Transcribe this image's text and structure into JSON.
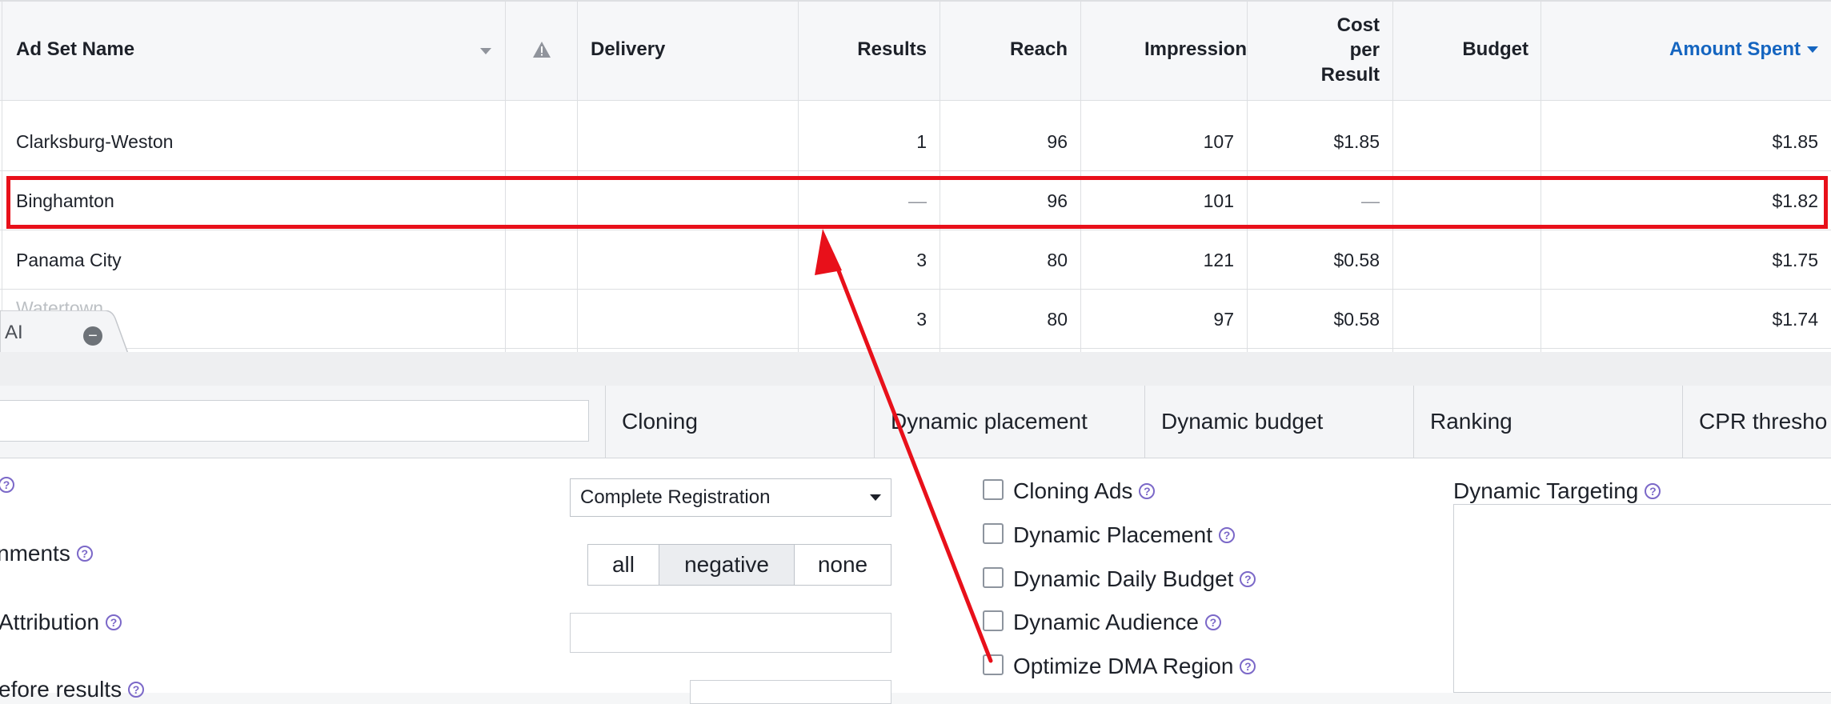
{
  "table": {
    "columns": [
      {
        "key": "name",
        "label": "Ad Set Name"
      },
      {
        "key": "warn",
        "label": ""
      },
      {
        "key": "delivery",
        "label": "Delivery"
      },
      {
        "key": "results",
        "label": "Results"
      },
      {
        "key": "reach",
        "label": "Reach"
      },
      {
        "key": "impressions",
        "label": "Impression"
      },
      {
        "key": "cpr",
        "label": "Cost\nper\nResult"
      },
      {
        "key": "budget",
        "label": "Budget"
      },
      {
        "key": "spent",
        "label": "Amount Spent"
      }
    ],
    "rows": [
      {
        "name": "Clarksburg-Weston",
        "results": "1",
        "reach": "96",
        "impressions": "107",
        "cpr": "$1.85",
        "spent": "$1.85"
      },
      {
        "name": "Binghamton",
        "results": "—",
        "reach": "96",
        "impressions": "101",
        "cpr": "—",
        "spent": "$1.82",
        "highlighted": true
      },
      {
        "name": "Panama City",
        "results": "3",
        "reach": "80",
        "impressions": "121",
        "cpr": "$0.58",
        "spent": "$1.75"
      },
      {
        "name": "Watertown",
        "results": "3",
        "reach": "80",
        "impressions": "97",
        "cpr": "$0.58",
        "spent": "$1.74"
      }
    ]
  },
  "panel": {
    "tab_label": "AI",
    "tabs": [
      "Cloning",
      "Dynamic placement",
      "Dynamic budget",
      "Ranking",
      "CPR thresho"
    ],
    "left": {
      "event_select": "Complete Registration",
      "comments_label": "nments",
      "segments": [
        "all",
        "negative",
        "none"
      ],
      "segment_active": "negative",
      "attribution_label": "Attribution",
      "before_results_label": "efore results"
    },
    "checkboxes": [
      "Cloning Ads",
      "Dynamic Placement",
      "Dynamic Daily Budget",
      "Dynamic Audience",
      "Optimize DMA Region"
    ],
    "dynamic_targeting_label": "Dynamic Targeting"
  },
  "colors": {
    "highlight": "#e8101a",
    "accent": "#1565c0",
    "help": "#7b68c8"
  }
}
